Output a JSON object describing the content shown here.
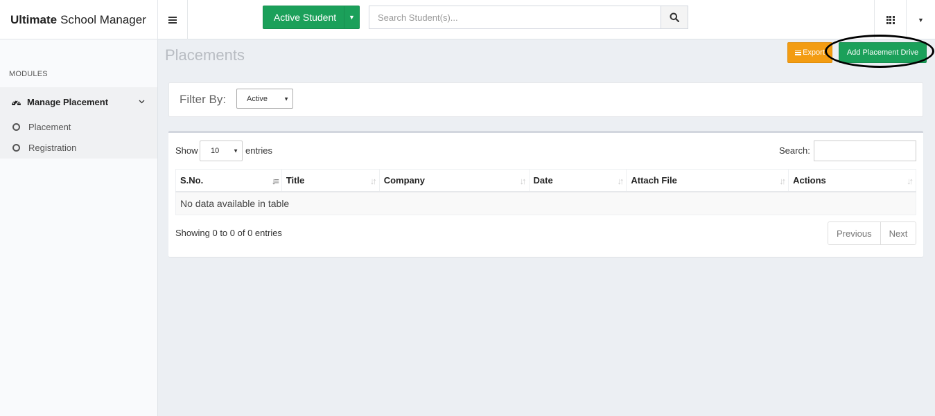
{
  "header": {
    "brand_bold": "Ultimate",
    "brand_rest": "School Manager",
    "active_student_label": "Active Student",
    "search_placeholder": "Search Student(s)...",
    "icons": {
      "menu": "hamburger-icon",
      "search": "search-icon",
      "apps": "grid-icon",
      "dropdown": "caret-down-icon"
    }
  },
  "sidebar": {
    "section_heading": "MODULES",
    "group": {
      "label": "Manage Placement",
      "icon": "dashboard-icon",
      "expanded": true,
      "items": [
        {
          "label": "Placement"
        },
        {
          "label": "Registration"
        }
      ]
    }
  },
  "main": {
    "page_title": "Placements",
    "export_label": "Export",
    "add_label": "Add Placement Drive",
    "filter": {
      "label": "Filter By:",
      "value": "Active"
    },
    "table": {
      "show_label": "Show",
      "page_length": "10",
      "entries_label": "entries",
      "search_label": "Search:",
      "columns": [
        "S.No.",
        "Title",
        "Company",
        "Date",
        "Attach File",
        "Actions"
      ],
      "empty_message": "No data available in table",
      "info": "Showing 0 to 0 of 0 entries",
      "pagination": {
        "previous": "Previous",
        "next": "Next"
      }
    }
  },
  "colors": {
    "success": "#1ba05a",
    "warning": "#f39c12",
    "background": "#eceff3",
    "highlight_ring": "#000000"
  }
}
